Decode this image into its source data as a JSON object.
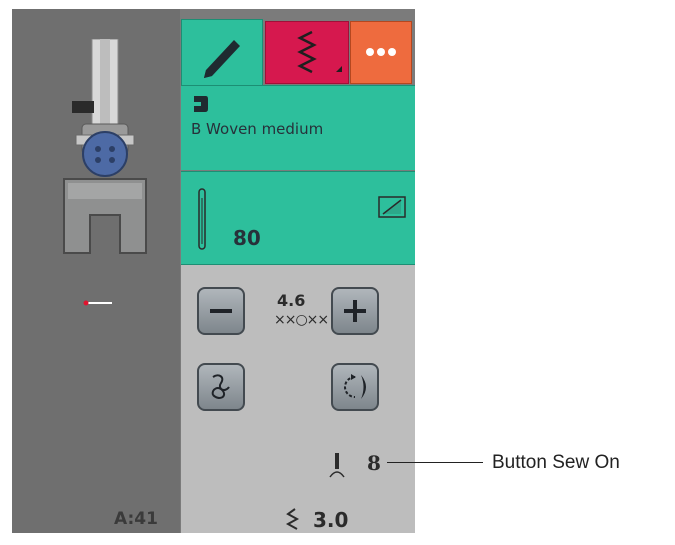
{
  "left_panel": {
    "pattern_label": "A:41",
    "icons": [
      "presser-foot-icon",
      "needle-position-icon"
    ]
  },
  "tabs": [
    {
      "name": "edit",
      "icon": "pencil-icon",
      "color": "#2dbf9c"
    },
    {
      "name": "stitch",
      "icon": "zigzag-icon",
      "color": "#d6184e"
    },
    {
      "name": "more",
      "icon": "dots-icon",
      "color": "#ee6b3e"
    }
  ],
  "fabric": {
    "name": "B Woven medium",
    "icon": "fabric-icon"
  },
  "needle": {
    "size": "80",
    "icons": [
      "needle-icon",
      "twin-needle-icon"
    ]
  },
  "controls": {
    "stitch_width": "4.6",
    "width_icon": "××○××",
    "thread_tension": "8",
    "stitch_length": "3.0",
    "icons": [
      "minus-icon",
      "plus-icon",
      "spiral-icon",
      "rotate-icon",
      "tension-icon",
      "stitch-length-icon"
    ]
  },
  "callout": {
    "label": "Button Sew On"
  },
  "colors": {
    "teal": "#2dbf9c",
    "pink": "#d6184e",
    "orange": "#ee6b3e",
    "grey_panel": "#bdbdbd",
    "dark_bg": "#6f6f6f"
  }
}
